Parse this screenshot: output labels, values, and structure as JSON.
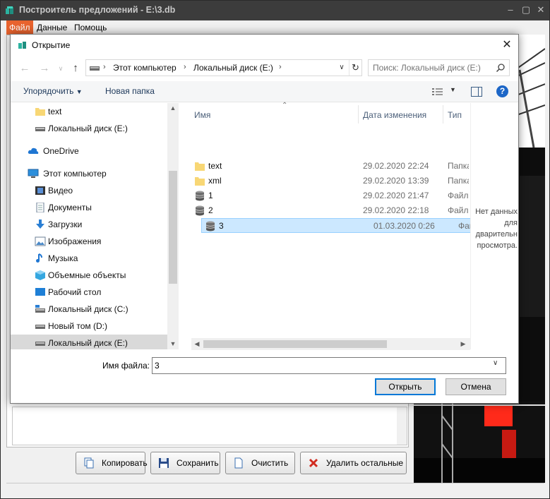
{
  "app": {
    "title": "Построитель предложений - E:\\3.db",
    "menu": [
      "Файл",
      "Данные",
      "Помощь"
    ],
    "buttons": {
      "copy": "Копировать",
      "save": "Сохранить",
      "clear": "Очистить",
      "delete_rest": "Удалить остальные"
    }
  },
  "dialog": {
    "title": "Открытие",
    "breadcrumbs": [
      "Этот компьютер",
      "Локальный диск (E:)"
    ],
    "search_placeholder": "Поиск: Локальный диск (E:)",
    "toolbar": {
      "organize": "Упорядочить",
      "new_folder": "Новая папка"
    },
    "nav_items": [
      {
        "label": "text",
        "icon": "folder-icon",
        "selected": false
      },
      {
        "label": "Локальный диск (E:)",
        "icon": "drive-icon",
        "selected": false
      },
      {
        "label": "OneDrive",
        "icon": "cloud-icon",
        "selected": false
      },
      {
        "label": "Этот компьютер",
        "icon": "computer-icon",
        "selected": false
      },
      {
        "label": "Видео",
        "icon": "video-icon",
        "selected": false
      },
      {
        "label": "Документы",
        "icon": "documents-icon",
        "selected": false
      },
      {
        "label": "Загрузки",
        "icon": "download-icon",
        "selected": false
      },
      {
        "label": "Изображения",
        "icon": "pictures-icon",
        "selected": false
      },
      {
        "label": "Музыка",
        "icon": "music-icon",
        "selected": false
      },
      {
        "label": "Объемные объекты",
        "icon": "3d-objects-icon",
        "selected": false
      },
      {
        "label": "Рабочий стол",
        "icon": "desktop-icon",
        "selected": false
      },
      {
        "label": "Локальный диск (C:)",
        "icon": "drive-icon",
        "selected": false
      },
      {
        "label": "Новый том (D:)",
        "icon": "drive-icon",
        "selected": false
      },
      {
        "label": "Локальный диск (E:)",
        "icon": "drive-icon",
        "selected": true
      }
    ],
    "columns": {
      "name": "Имя",
      "date": "Дата изменения",
      "type": "Тип"
    },
    "files": [
      {
        "name": "text",
        "date": "29.02.2020 22:24",
        "type": "Папка",
        "icon": "folder-icon",
        "selected": false
      },
      {
        "name": "xml",
        "date": "29.02.2020 13:39",
        "type": "Папка",
        "icon": "folder-icon",
        "selected": false
      },
      {
        "name": "1",
        "date": "29.02.2020 21:47",
        "type": "Файл",
        "icon": "database-icon",
        "selected": false
      },
      {
        "name": "2",
        "date": "29.02.2020 22:18",
        "type": "Файл",
        "icon": "database-icon",
        "selected": false
      },
      {
        "name": "3",
        "date": "01.03.2020 0:26",
        "type": "Файл",
        "icon": "database-icon",
        "selected": true
      }
    ],
    "preview_text": "Нет данных\nдля\nдварительн\nпросмотра.",
    "filename_label": "Имя файла:",
    "filename_value": "3",
    "open_button": "Открыть",
    "cancel_button": "Отмена"
  },
  "colors": {
    "accent": "#e8632e",
    "selection": "#cce8ff",
    "default_button_border": "#0078d7"
  }
}
